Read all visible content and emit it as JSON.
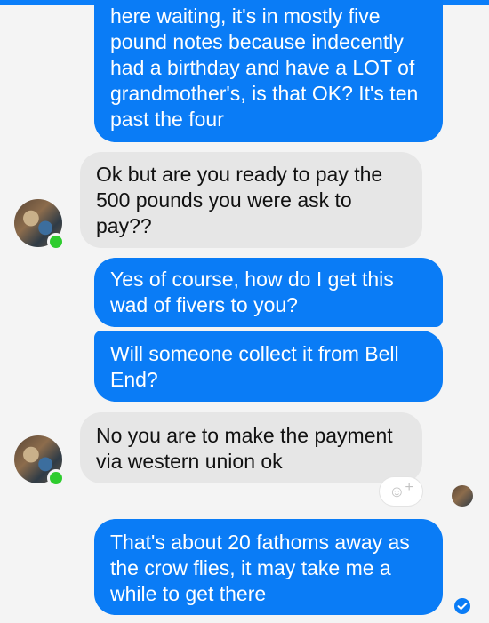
{
  "messages": [
    {
      "from": "me",
      "text": "here waiting, it's in mostly five pound notes because indecently had a birthday and have a LOT of grandmother's, is that OK? It's ten past the four"
    },
    {
      "from": "them",
      "text": "Ok but are you ready to pay the 500 pounds you were ask to pay??"
    },
    {
      "from": "me",
      "text": "Yes of course, how do I get this wad of fivers to you?"
    },
    {
      "from": "me",
      "text": "Will someone collect it from Bell End?"
    },
    {
      "from": "them",
      "text": "No you are to make the payment via western union ok"
    },
    {
      "from": "me",
      "text": "That's about 20 fathoms away as the crow flies, it may take me a while to get there"
    }
  ],
  "reaction_button": {
    "icon": "smiley-add-icon",
    "glyph": "☺",
    "plus": "+"
  },
  "colors": {
    "outgoing": "#0a7cf6",
    "incoming": "#e6e6e6",
    "online": "#2ecc2e",
    "background": "#f4f4f4"
  }
}
